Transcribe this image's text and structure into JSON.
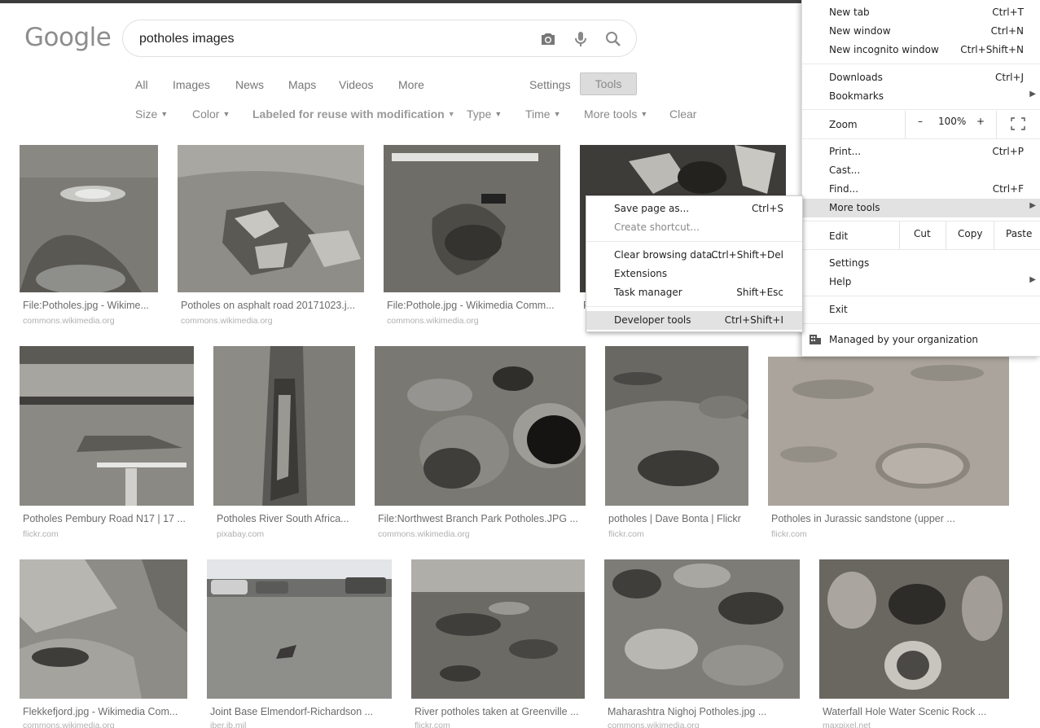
{
  "search": {
    "logo": "Google",
    "query": "potholes images",
    "icons": {
      "camera": "camera-icon",
      "mic": "mic-icon",
      "search": "search-icon"
    }
  },
  "tabs": [
    {
      "label": "All"
    },
    {
      "label": "Images"
    },
    {
      "label": "News"
    },
    {
      "label": "Maps"
    },
    {
      "label": "Videos"
    },
    {
      "label": "More"
    }
  ],
  "settings_label": "Settings",
  "tools_label": "Tools",
  "filters": {
    "size": "Size",
    "color": "Color",
    "rights": "Labeled for reuse with modification",
    "type": "Type",
    "time": "Time",
    "more_tools": "More tools",
    "clear": "Clear"
  },
  "results": [
    {
      "caption": "File:Potholes.jpg - Wikime...",
      "source": "commons.wikimedia.org"
    },
    {
      "caption": "Potholes on asphalt road 20171023.j...",
      "source": "commons.wikimedia.org"
    },
    {
      "caption": "File:Pothole.jpg - Wikimedia Comm...",
      "source": "commons.wikimedia.org"
    },
    {
      "caption": "F",
      "source": ""
    },
    {
      "caption": "Potholes Pembury Road N17 | 17 ...",
      "source": "flickr.com"
    },
    {
      "caption": "Potholes River South Africa...",
      "source": "pixabay.com"
    },
    {
      "caption": "File:Northwest Branch Park Potholes.JPG ...",
      "source": "commons.wikimedia.org"
    },
    {
      "caption": "potholes | Dave Bonta | Flickr",
      "source": "flickr.com"
    },
    {
      "caption": "Potholes in Jurassic sandstone (upper ...",
      "source": "flickr.com"
    },
    {
      "caption": "Flekkefjord.jpg - Wikimedia Com...",
      "source": "commons.wikimedia.org"
    },
    {
      "caption": "Joint Base Elmendorf-Richardson ...",
      "source": "jber.jb.mil"
    },
    {
      "caption": "River potholes taken at Greenville ...",
      "source": "flickr.com"
    },
    {
      "caption": "Maharashtra Nighoj Potholes.jpg ...",
      "source": "commons.wikimedia.org"
    },
    {
      "caption": "Waterfall Hole Water Scenic Rock ...",
      "source": "maxpixel.net"
    }
  ],
  "chrome_menu": {
    "new_tab": {
      "label": "New tab",
      "shortcut": "Ctrl+T"
    },
    "new_window": {
      "label": "New window",
      "shortcut": "Ctrl+N"
    },
    "incognito": {
      "label": "New incognito window",
      "shortcut": "Ctrl+Shift+N"
    },
    "downloads": {
      "label": "Downloads",
      "shortcut": "Ctrl+J"
    },
    "bookmarks": {
      "label": "Bookmarks"
    },
    "zoom": {
      "label": "Zoom",
      "minus": "–",
      "value": "100%",
      "plus": "+"
    },
    "print": {
      "label": "Print...",
      "shortcut": "Ctrl+P"
    },
    "cast": {
      "label": "Cast..."
    },
    "find": {
      "label": "Find...",
      "shortcut": "Ctrl+F"
    },
    "more_tools": {
      "label": "More tools"
    },
    "edit": {
      "label": "Edit",
      "cut": "Cut",
      "copy": "Copy",
      "paste": "Paste"
    },
    "settings": {
      "label": "Settings"
    },
    "help": {
      "label": "Help"
    },
    "exit": {
      "label": "Exit"
    },
    "managed": {
      "label": "Managed by your organization"
    }
  },
  "more_tools_submenu": {
    "save_page": {
      "label": "Save page as...",
      "shortcut": "Ctrl+S"
    },
    "create_shortcut": {
      "label": "Create shortcut..."
    },
    "clear_data": {
      "label": "Clear browsing data...",
      "shortcut": "Ctrl+Shift+Del"
    },
    "extensions": {
      "label": "Extensions"
    },
    "task_manager": {
      "label": "Task manager",
      "shortcut": "Shift+Esc"
    },
    "dev_tools": {
      "label": "Developer tools",
      "shortcut": "Ctrl+Shift+I"
    }
  }
}
